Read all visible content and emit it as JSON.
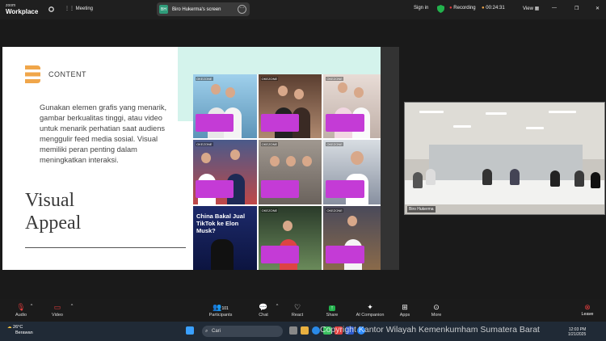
{
  "app": {
    "logo_line1": "zoom",
    "logo_line2": "Workplace",
    "meeting_label": "Meeting"
  },
  "share": {
    "avatar": "BH",
    "label": "Biro Hukerma's screen"
  },
  "header_right": {
    "signin": "Sign in",
    "recording": "Recording",
    "time": "00:24:31",
    "view": "View"
  },
  "slide": {
    "heading": "CONTENT",
    "body": "Gunakan elemen grafis yang menarik, gambar berkualitas tinggi, atau video untuk menarik perhatian saat audiens menggulir feed media sosial. Visual memiliki peran penting dalam meningkatkan interaksi.",
    "title_line1": "Visual",
    "title_line2": "Appeal",
    "tiles": [
      {
        "tag": "OKEZONE",
        "bg": "#7fb8d8"
      },
      {
        "tag": "OKEZONE",
        "bg": "#b89070"
      },
      {
        "tag": "OKEZONE",
        "bg": "#d8c8c0"
      },
      {
        "tag": "OKEZONE",
        "bg": "#c04848"
      },
      {
        "tag": "OKEZONE",
        "bg": "#8a7a70"
      },
      {
        "tag": "OKEZONE",
        "bg": "#a8b4c0"
      },
      {
        "tag": "",
        "bg": "#1d2a6a",
        "headline": "China Bakal Jual TikTok ke Elon Musk?"
      },
      {
        "tag": "OKEZONE",
        "bg": "#4a5a4a"
      },
      {
        "tag": "OKEZONE",
        "bg": "#6a5a4a"
      }
    ]
  },
  "camera": {
    "name": "Biro Hukerma"
  },
  "toolbar": {
    "audio": "Audio",
    "video": "Video",
    "participants": "Participants",
    "participants_count": "101",
    "chat": "Chat",
    "react": "React",
    "share": "Share",
    "ai": "AI Companion",
    "apps": "Apps",
    "more": "More",
    "leave": "Leave"
  },
  "taskbar": {
    "temp": "26°C",
    "weather": "Berawan",
    "search": "Cari",
    "time": "12:03 PM",
    "date": "1/21/2025"
  },
  "watermark": "Copyright Kantor Wilayah Kemenkumham Sumatera Barat",
  "colors": {
    "share_green": "#22b24c",
    "record_red": "#e03c3c",
    "brand_orange": "#f0a64a",
    "mint": "#d4f3ec"
  }
}
